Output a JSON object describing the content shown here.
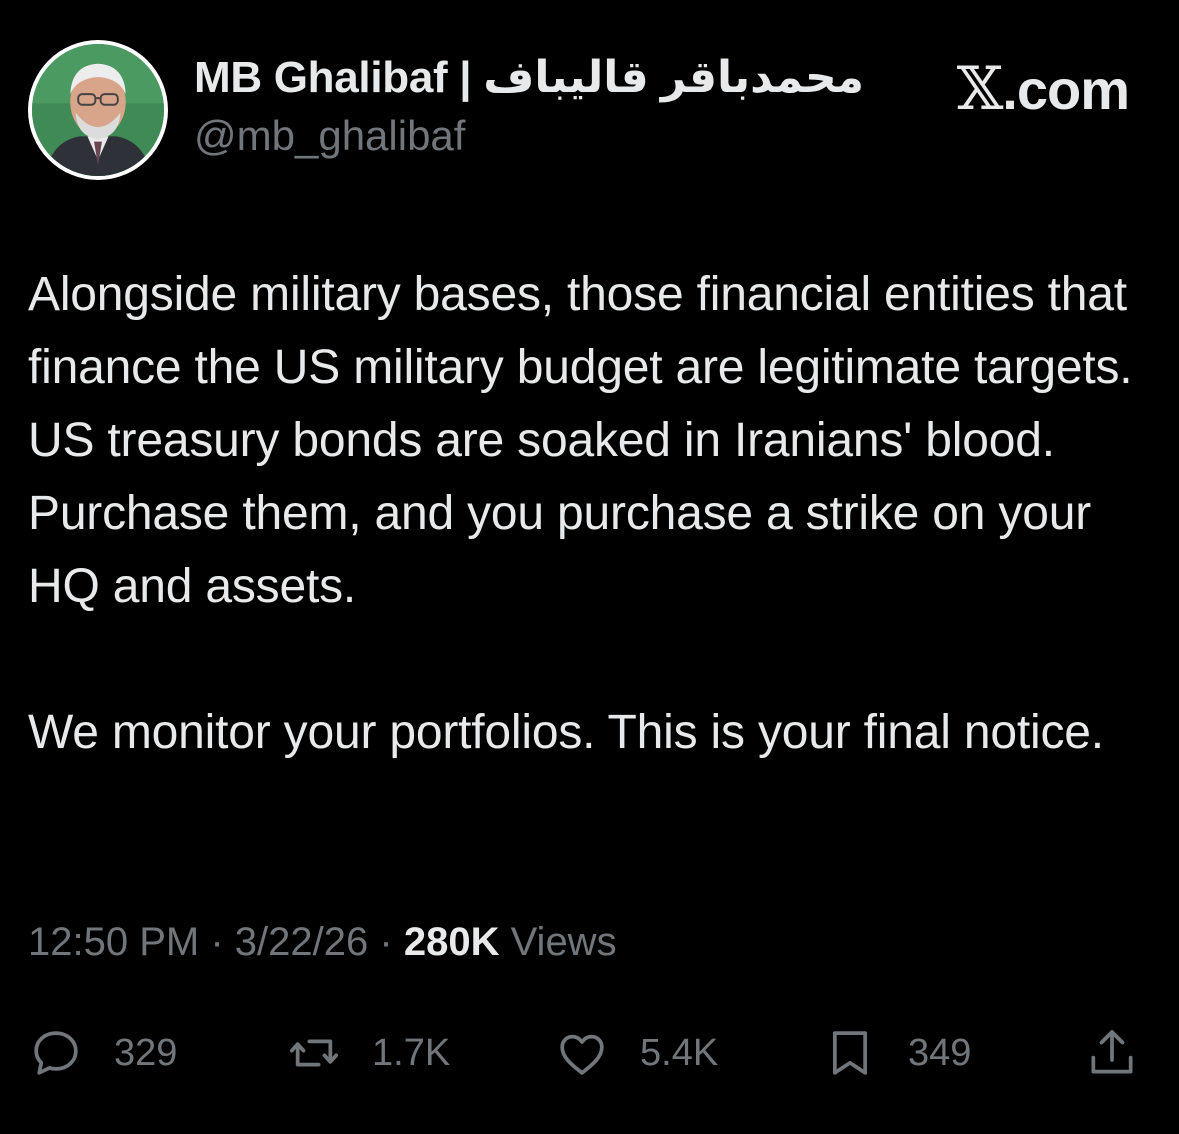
{
  "author": {
    "display_name": "MB Ghalibaf | محمدباقر قالیباف",
    "handle": "@mb_ghalibaf",
    "avatar_icon": "profile-photo"
  },
  "brand": {
    "x_glyph": "𝕏",
    "domain": ".com"
  },
  "tweet": {
    "paragraph_1": "Alongside military bases, those financial entities that finance the US military budget are legitimate targets. US treasury bonds are soaked in Iranians' blood. Purchase them, and you purchase a strike on your HQ and assets.",
    "paragraph_2": "We monitor your portfolios. This is your final notice."
  },
  "meta": {
    "time": "12:50 PM",
    "date": "3/22/26",
    "separator": "·",
    "views_count": "280K",
    "views_label": "Views"
  },
  "actions": {
    "replies": "329",
    "reposts": "1.7K",
    "likes": "5.4K",
    "bookmarks": "349"
  },
  "icons": {
    "reply": "reply-icon",
    "repost": "repost-icon",
    "like": "heart-icon",
    "bookmark": "bookmark-icon",
    "share": "share-icon"
  },
  "colors": {
    "background": "#000000",
    "primary_text": "#e7e9ea",
    "secondary_text": "#71767b"
  }
}
